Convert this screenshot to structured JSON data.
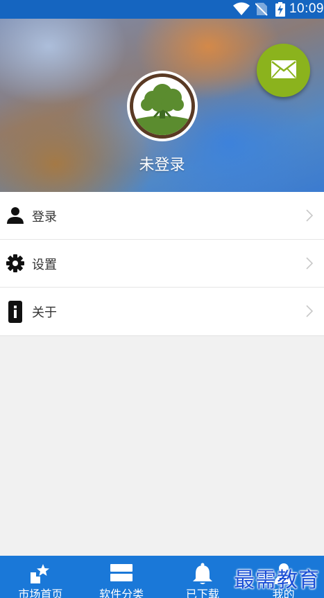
{
  "status_bar": {
    "time": "10:09",
    "icons": [
      "wifi-icon",
      "no-sim-icon",
      "battery-charging-icon"
    ]
  },
  "profile": {
    "name": "未登录",
    "avatar_icon": "tree-icon",
    "fab_icon": "mail-icon",
    "fab_color": "#8bb31d"
  },
  "menu": {
    "items": [
      {
        "label": "登录",
        "icon": "person-icon"
      },
      {
        "label": "设置",
        "icon": "gear-icon"
      },
      {
        "label": "关于",
        "icon": "info-icon"
      }
    ]
  },
  "bottom_nav": {
    "color": "#1a78d8",
    "items": [
      {
        "label": "市场首页",
        "icon": "star-box-icon"
      },
      {
        "label": "软件分类",
        "icon": "category-icon"
      },
      {
        "label": "已下载",
        "icon": "bell-icon"
      },
      {
        "label": "我的",
        "icon": "person-icon"
      }
    ]
  },
  "watermark": "最需教育"
}
